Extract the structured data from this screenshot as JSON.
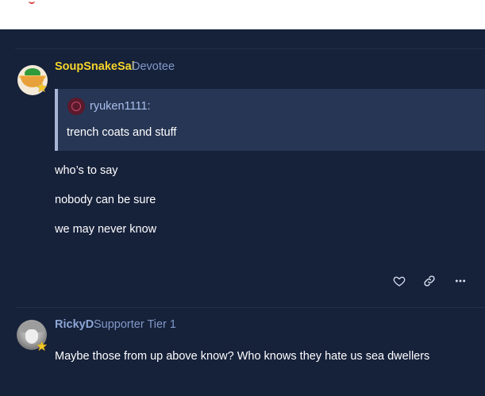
{
  "post1": {
    "username": "SoupSnakeSal",
    "usertitle": "Devotee",
    "quote": {
      "user": "ryuken1111:",
      "text": "trench coats and stuff"
    },
    "lines": [
      "who’s to say",
      "nobody can be sure",
      "we may never know"
    ],
    "actions": {
      "like_icon": "heart-icon",
      "link_icon": "link-icon",
      "more_icon": "ellipsis-icon"
    }
  },
  "post2": {
    "username": "RickyD",
    "usertitle": "Supporter Tier 1",
    "text": "Maybe those from up above know? Who knows they hate us sea dwellers"
  },
  "colors": {
    "background": "#16213a",
    "username_gold": "#f5d52c",
    "username_blue": "#8ea7d6",
    "usertitle": "#8199c9",
    "quote_bg": "#273654",
    "quote_border": "#a7b6d6"
  }
}
